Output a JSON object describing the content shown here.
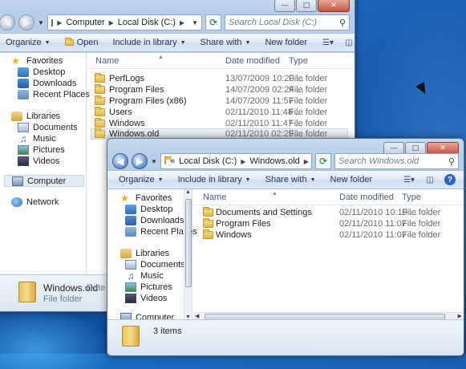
{
  "back_window": {
    "address": {
      "segments": [
        "Computer",
        "Local Disk (C:)"
      ],
      "search_placeholder": "Search Local Disk (C:)"
    },
    "toolbar": {
      "organize": "Organize",
      "open": "Open",
      "include_in_library": "Include in library",
      "share_with": "Share with",
      "new_folder": "New folder"
    },
    "nav": {
      "favorites": "Favorites",
      "desktop": "Desktop",
      "downloads": "Downloads",
      "recent_places": "Recent Places",
      "libraries": "Libraries",
      "documents": "Documents",
      "music": "Music",
      "pictures": "Pictures",
      "videos": "Videos",
      "computer": "Computer",
      "network": "Network"
    },
    "columns": {
      "name": "Name",
      "date": "Date modified",
      "type": "Type"
    },
    "files": [
      {
        "name": "PerfLogs",
        "date": "13/07/2009 10:20 ...",
        "type": "File folder"
      },
      {
        "name": "Program Files",
        "date": "14/07/2009 02:24 ...",
        "type": "File folder"
      },
      {
        "name": "Program Files (x86)",
        "date": "14/07/2009 11:57 ...",
        "type": "File folder"
      },
      {
        "name": "Users",
        "date": "02/11/2010 11:48 ...",
        "type": "File folder"
      },
      {
        "name": "Windows",
        "date": "02/11/2010 11:47 ...",
        "type": "File folder"
      },
      {
        "name": "Windows.old",
        "date": "02/11/2010 02:29 ...",
        "type": "File folder"
      }
    ],
    "details": {
      "name": "Windows.old",
      "extra": "Date me",
      "type": "File folder"
    }
  },
  "front_window": {
    "address": {
      "prefix": "«",
      "segments": [
        "Local Disk (C:)",
        "Windows.old"
      ],
      "search_placeholder": "Search Windows.old"
    },
    "toolbar": {
      "organize": "Organize",
      "include_in_library": "Include in library",
      "share_with": "Share with",
      "new_folder": "New folder"
    },
    "nav": {
      "favorites": "Favorites",
      "desktop": "Desktop",
      "downloads": "Downloads",
      "recent_places": "Recent Places",
      "libraries": "Libraries",
      "documents": "Documents",
      "music": "Music",
      "pictures": "Pictures",
      "videos": "Videos",
      "computer": "Computer"
    },
    "columns": {
      "name": "Name",
      "date": "Date modified",
      "type": "Type"
    },
    "files": [
      {
        "name": "Documents and Settings",
        "date": "02/11/2010 10:19 ...",
        "type": "File folder"
      },
      {
        "name": "Program Files",
        "date": "02/11/2010 11:07 ...",
        "type": "File folder"
      },
      {
        "name": "Windows",
        "date": "02/11/2010 11:07 ...",
        "type": "File folder"
      }
    ],
    "details": {
      "count": "3 items"
    }
  }
}
